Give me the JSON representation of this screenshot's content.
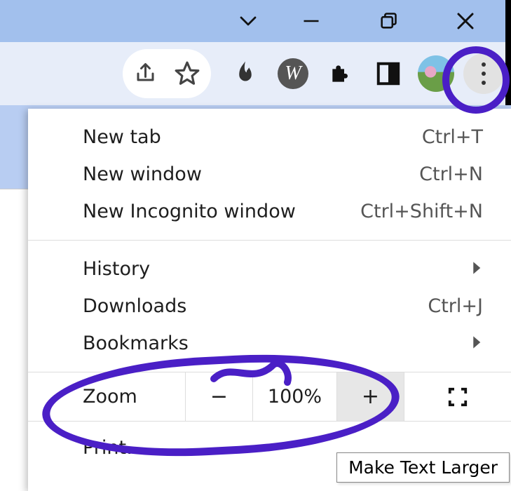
{
  "titlebar": {
    "dropdown_icon": "chevron-down",
    "minimize_icon": "minimize",
    "maximize_icon": "restore",
    "close_icon": "close"
  },
  "toolbar": {
    "share_icon": "share",
    "star_icon": "star",
    "dragon_icon": "flame",
    "wolfram_icon": "w",
    "extensions_icon": "puzzle",
    "reader_icon": "reader-mode",
    "avatar_icon": "profile-avatar",
    "menu_icon": "kebab-menu"
  },
  "menu": {
    "new_tab": {
      "label": "New tab",
      "shortcut": "Ctrl+T"
    },
    "new_window": {
      "label": "New window",
      "shortcut": "Ctrl+N"
    },
    "new_incognito": {
      "label": "New Incognito window",
      "shortcut": "Ctrl+Shift+N"
    },
    "history": {
      "label": "History"
    },
    "downloads": {
      "label": "Downloads",
      "shortcut": "Ctrl+J"
    },
    "bookmarks": {
      "label": "Bookmarks"
    },
    "zoom": {
      "label": "Zoom",
      "minus": "−",
      "value": "100%",
      "plus": "+",
      "fullscreen_icon": "fullscreen"
    },
    "print": {
      "label": "Print…"
    }
  },
  "tooltip": {
    "text": "Make Text Larger"
  },
  "annotation": {
    "color": "#4a1fc6"
  }
}
